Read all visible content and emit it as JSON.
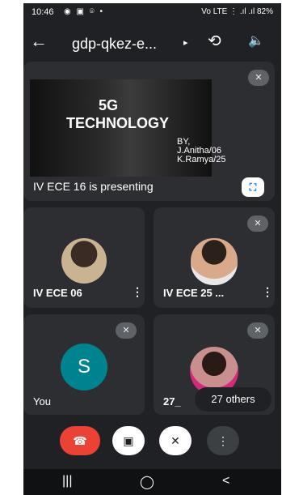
{
  "status": {
    "time": "10:46",
    "icons": "◉ ▣ ⌾ •",
    "right": "Vo LTE ⋮ .ıl .ıl 82%"
  },
  "top": {
    "back": "←",
    "title": "gdp-qkez-e...",
    "caret": "▸",
    "swap_camera": "⟲",
    "audio": "🔈"
  },
  "presentation": {
    "slide_title_1": "5G",
    "slide_title_2": "TECHNOLOGY",
    "slide_by": "BY,",
    "slide_author_1": "J.Anitha/06",
    "slide_author_2": "K.Ramya/25",
    "label": "IV ECE 16 is presenting",
    "fullscreen": "⛶"
  },
  "participants": [
    {
      "name": "IV ECE 06",
      "menu": "⋮"
    },
    {
      "name": "IV ECE 25 ...",
      "menu": "⋮"
    },
    {
      "name": "You",
      "initial": "S"
    },
    {
      "name": "27_",
      "others": "27 others"
    }
  ],
  "controls": {
    "end_call": "☎",
    "camera": "▣",
    "mic": "✕",
    "more": "⋮"
  },
  "nav": {
    "recent": "|||",
    "home": "◯",
    "back": "<"
  },
  "colors": {
    "end_call": "#ea4335",
    "avatar_s": "#00838f",
    "bg": "#202124",
    "tile": "#2d2e31"
  }
}
